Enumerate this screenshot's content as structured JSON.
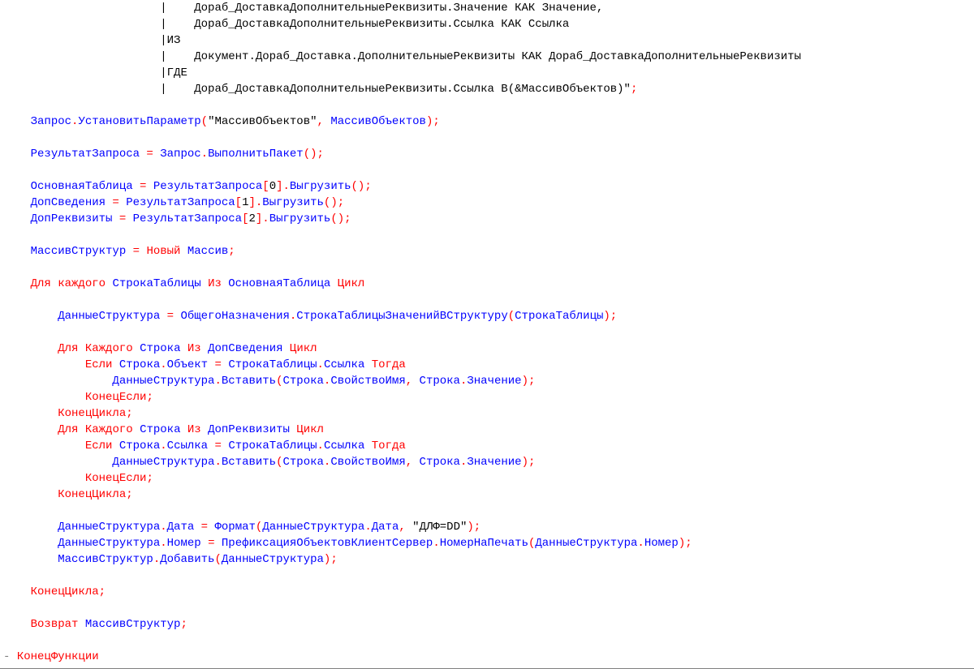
{
  "code": {
    "l01a": "|    Дораб_ДоставкаДополнительныеРеквизиты.Значение КАК Значение,",
    "l02a": "|    Дораб_ДоставкаДополнительныеРеквизиты.Ссылка КАК Ссылка",
    "l03a": "|ИЗ",
    "l04a": "|    Документ.Дораб_Доставка.ДополнительныеРеквизиты КАК Дораб_ДоставкаДополнительныеРеквизиты",
    "l05a": "|ГДЕ",
    "l06a": "|    Дораб_ДоставкаДополнительныеРеквизиты.Ссылка В(&МассивОбъектов)\"",
    "l06p": ";",
    "l08_obj": "Запрос",
    "l08_d1": ".",
    "l08_m": "УстановитьПараметр",
    "l08_po": "(",
    "l08_s": "\"МассивОбъектов\"",
    "l08_c": ", ",
    "l08_a": "МассивОбъектов",
    "l08_pc": ")",
    "l08_sc": ";",
    "l10_v": "РезультатЗапроса",
    "l10_eq": " = ",
    "l10_o": "Запрос",
    "l10_d": ".",
    "l10_m": "ВыполнитьПакет",
    "l10_p": "()",
    "l10_sc": ";",
    "l12_v": "ОсновнаяТаблица",
    "l12_eq": " = ",
    "l12_o": "РезультатЗапроса",
    "l12_b": "[",
    "l12_i": "0",
    "l12_b2": "].",
    "l12_m": "Выгрузить",
    "l12_p": "()",
    "l12_sc": ";",
    "l13_v": "ДопСведения",
    "l13_eq": " = ",
    "l13_o": "РезультатЗапроса",
    "l13_b": "[",
    "l13_i": "1",
    "l13_b2": "].",
    "l13_m": "Выгрузить",
    "l13_p": "()",
    "l13_sc": ";",
    "l14_v": "ДопРеквизиты",
    "l14_eq": " = ",
    "l14_o": "РезультатЗапроса",
    "l14_b": "[",
    "l14_i": "2",
    "l14_b2": "].",
    "l14_m": "Выгрузить",
    "l14_p": "()",
    "l14_sc": ";",
    "l16_v": "МассивСтруктур",
    "l16_eq": " = ",
    "l16_n": "Новый",
    "l16_sp": " ",
    "l16_t": "Массив",
    "l16_sc": ";",
    "l18_for": "Для",
    "l18_each": " каждого ",
    "l18_it": "СтрокаТаблицы",
    "l18_in": " Из ",
    "l18_src": "ОсновнаяТаблица",
    "l18_do": " Цикл",
    "l20_v": "ДанныеСтруктура",
    "l20_eq": " = ",
    "l20_o": "ОбщегоНазначения",
    "l20_d": ".",
    "l20_m": "СтрокаТаблицыЗначенийВСтруктуру",
    "l20_po": "(",
    "l20_a": "СтрокаТаблицы",
    "l20_pc": ")",
    "l20_sc": ";",
    "l22_for": "Для",
    "l22_each": " Каждого ",
    "l22_it": "Строка",
    "l22_in": " Из ",
    "l22_src": "ДопСведения",
    "l22_do": " Цикл",
    "l23_if": "Если",
    "l23_sp": " ",
    "l23_l": "Строка",
    "l23_d1": ".",
    "l23_lp": "Объект",
    "l23_eq": " = ",
    "l23_r": "СтрокаТаблицы",
    "l23_d2": ".",
    "l23_rp": "Ссылка",
    "l23_th": " Тогда",
    "l24_o": "ДанныеСтруктура",
    "l24_d": ".",
    "l24_m": "Вставить",
    "l24_po": "(",
    "l24_a1o": "Строка",
    "l24_a1d": ".",
    "l24_a1p": "СвойствоИмя",
    "l24_c": ", ",
    "l24_a2o": "Строка",
    "l24_a2d": ".",
    "l24_a2p": "Значение",
    "l24_pc": ")",
    "l24_sc": ";",
    "l25_endif": "КонецЕсли",
    "l25_sc": ";",
    "l26_endloop": "КонецЦикла",
    "l26_sc": ";",
    "l27_for": "Для",
    "l27_each": " Каждого ",
    "l27_it": "Строка",
    "l27_in": " Из ",
    "l27_src": "ДопРеквизиты",
    "l27_do": " Цикл",
    "l28_if": "Если",
    "l28_sp": " ",
    "l28_l": "Строка",
    "l28_d1": ".",
    "l28_lp": "Ссылка",
    "l28_eq": " = ",
    "l28_r": "СтрокаТаблицы",
    "l28_d2": ".",
    "l28_rp": "Ссылка",
    "l28_th": " Тогда",
    "l29_o": "ДанныеСтруктура",
    "l29_d": ".",
    "l29_m": "Вставить",
    "l29_po": "(",
    "l29_a1o": "Строка",
    "l29_a1d": ".",
    "l29_a1p": "СвойствоИмя",
    "l29_c": ", ",
    "l29_a2o": "Строка",
    "l29_a2d": ".",
    "l29_a2p": "Значение",
    "l29_pc": ")",
    "l29_sc": ";",
    "l30_endif": "КонецЕсли",
    "l30_sc": ";",
    "l31_endloop": "КонецЦикла",
    "l31_sc": ";",
    "l33_o": "ДанныеСтруктура",
    "l33_d": ".",
    "l33_p": "Дата",
    "l33_eq": " = ",
    "l33_f": "Формат",
    "l33_po": "(",
    "l33_a1o": "ДанныеСтруктура",
    "l33_a1d": ".",
    "l33_a1p": "Дата",
    "l33_c": ", ",
    "l33_s": "\"ДЛФ=DD\"",
    "l33_pc": ")",
    "l33_sc": ";",
    "l34_o": "ДанныеСтруктура",
    "l34_d": ".",
    "l34_p": "Номер",
    "l34_eq": " = ",
    "l34_mobj": "ПрефиксацияОбъектовКлиентСервер",
    "l34_md": ".",
    "l34_m": "НомерНаПечать",
    "l34_po": "(",
    "l34_a1o": "ДанныеСтруктура",
    "l34_a1d": ".",
    "l34_a1p": "Номер",
    "l34_pc": ")",
    "l34_sc": ";",
    "l35_o": "МассивСтруктур",
    "l35_d": ".",
    "l35_m": "Добавить",
    "l35_po": "(",
    "l35_a": "ДанныеСтруктура",
    "l35_pc": ")",
    "l35_sc": ";",
    "l37_endloop": "КонецЦикла",
    "l37_sc": ";",
    "l39_ret": "Возврат",
    "l39_sp": " ",
    "l39_v": "МассивСтруктур",
    "l39_sc": ";",
    "fold": "- ",
    "l41_endfn": "КонецФункции"
  }
}
